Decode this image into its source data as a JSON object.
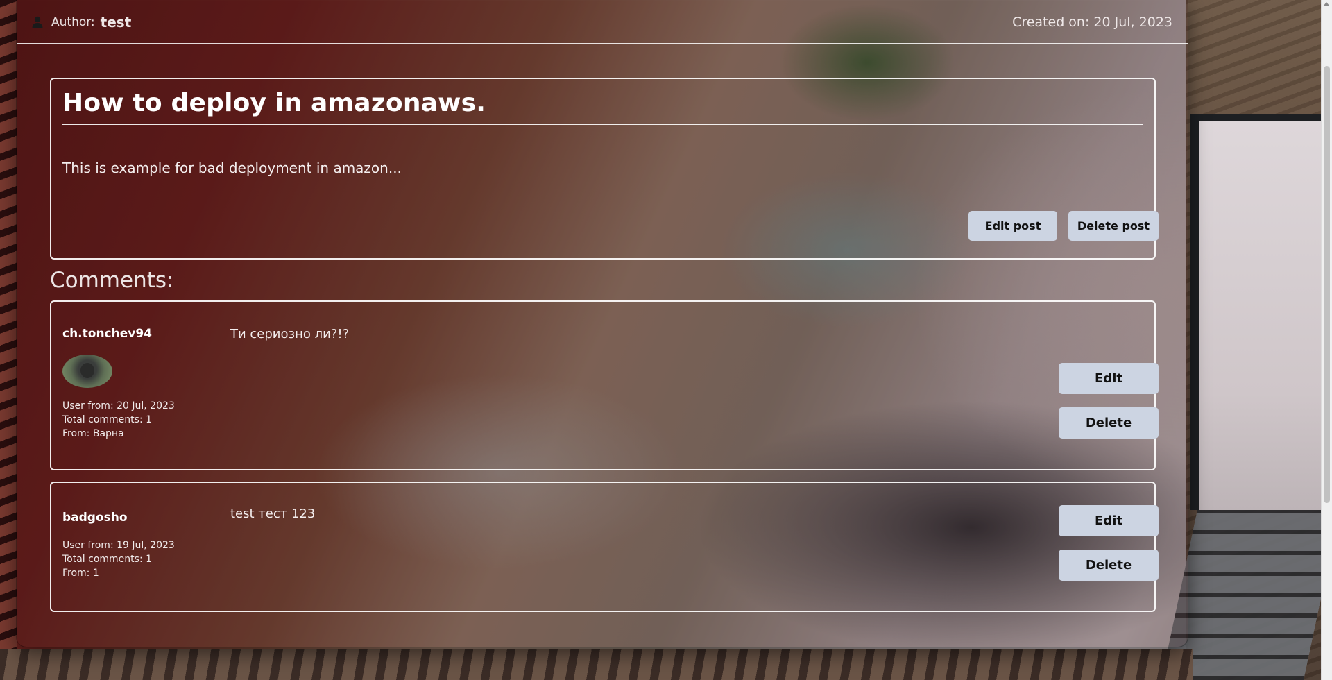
{
  "header": {
    "author_label": "Author:",
    "author_name": "test",
    "created": "Created on: 20 Jul, 2023"
  },
  "post": {
    "title": "How to deploy in amazonaws.",
    "body": "This is example for bad deployment in amazon...",
    "edit_label": "Edit post",
    "delete_label": "Delete post"
  },
  "comments_heading": "Comments:",
  "comments": [
    {
      "username": "ch.tonchev94",
      "has_avatar": true,
      "user_from": "User from: 20 Jul, 2023",
      "total_comments": "Total comments: 1",
      "from": "From: Варна",
      "text": "Ти сериозно ли?!?",
      "edit_label": "Edit",
      "delete_label": "Delete"
    },
    {
      "username": "badgosho",
      "has_avatar": false,
      "user_from": "User from: 19 Jul, 2023",
      "total_comments": "Total comments: 1",
      "from": "From: 1",
      "text": "test тест 123",
      "edit_label": "Edit",
      "delete_label": "Delete"
    }
  ],
  "icons": {
    "author": "person-icon"
  },
  "colors": {
    "button_bg": "#ccd4e2",
    "button_text": "#111111",
    "border": "#ffffff"
  }
}
